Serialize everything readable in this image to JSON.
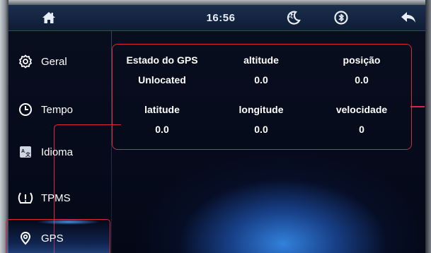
{
  "statusbar": {
    "time": "16:56",
    "icons": [
      "home-icon",
      "night-mode-icon",
      "bluetooth-icon",
      "back-arrow-icon"
    ]
  },
  "sidebar": {
    "items": [
      {
        "label": "Geral",
        "icon": "gear-icon",
        "selected": false
      },
      {
        "label": "Tempo",
        "icon": "clock-icon",
        "selected": false
      },
      {
        "label": "Idioma",
        "icon": "language-icon",
        "selected": false
      },
      {
        "label": "TPMS",
        "icon": "tire-pressure-icon",
        "selected": false
      },
      {
        "label": "GPS",
        "icon": "location-pin-icon",
        "selected": true
      }
    ]
  },
  "gps_panel": {
    "status_label": "Estado do GPS",
    "status_value": "Unlocated",
    "altitude_label": "altitude",
    "altitude_value": "0.0",
    "position_label": "posição",
    "position_value": "0.0",
    "latitude_label": "latitude",
    "latitude_value": "0.0",
    "longitude_label": "longitude",
    "longitude_value": "0.0",
    "speed_label": "velocidade",
    "speed_value": "0"
  },
  "colors": {
    "highlight": "#d8283a",
    "accent_blue": "#3a96ff",
    "background": "#050a1c"
  }
}
